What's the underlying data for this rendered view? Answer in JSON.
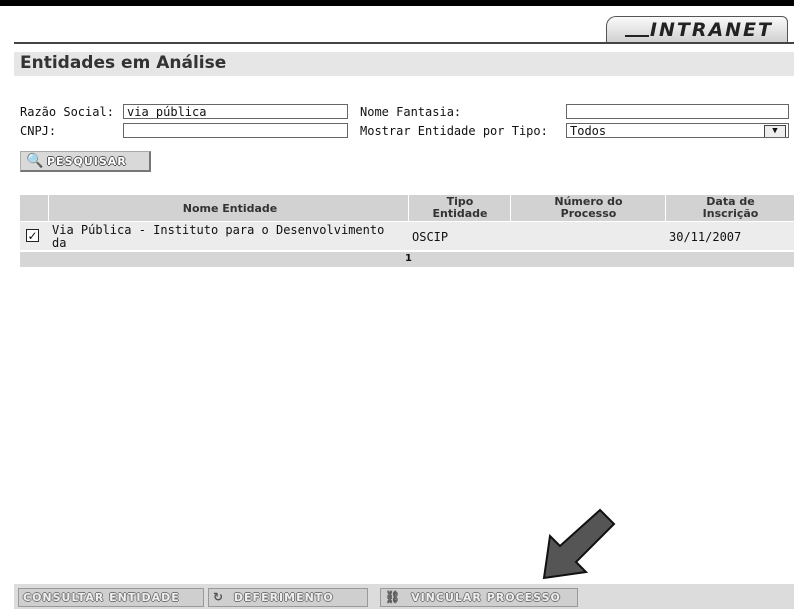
{
  "header": {
    "brand": "INTRANET"
  },
  "page": {
    "title": "Entidades em Análise"
  },
  "form": {
    "razao_social_label": "Razão Social:",
    "razao_social_value": "via pública",
    "nome_fantasia_label": "Nome Fantasia:",
    "nome_fantasia_value": "",
    "cnpj_label": "CNPJ:",
    "cnpj_value": "",
    "tipo_label": "Mostrar Entidade por Tipo:",
    "tipo_value": "Todos",
    "search_label": "PESQUISAR"
  },
  "table": {
    "headers": {
      "nome": "Nome Entidade",
      "tipo_line1": "Tipo",
      "tipo_line2": "Entidade",
      "processo_line1": "Número do",
      "processo_line2": "Processo",
      "data_line1": "Data de",
      "data_line2": "Inscrição"
    },
    "rows": [
      {
        "checked": "✓",
        "nome_line1": "Via Pública - Instituto para o Desenvolvimento",
        "nome_line2": "da",
        "tipo": "OSCIP",
        "processo": "",
        "data": "30/11/2007"
      }
    ],
    "page": "1"
  },
  "actions": {
    "consultar": "CONSULTAR ENTIDADE",
    "deferimento": "DEFERIMENTO",
    "vincular": "VINCULAR PROCESSO"
  },
  "icons": {
    "search": "magnifier-icon",
    "deferimento": "circle-arrows-icon",
    "vincular": "link-icon",
    "pointer": "arrow-pointer-icon"
  }
}
